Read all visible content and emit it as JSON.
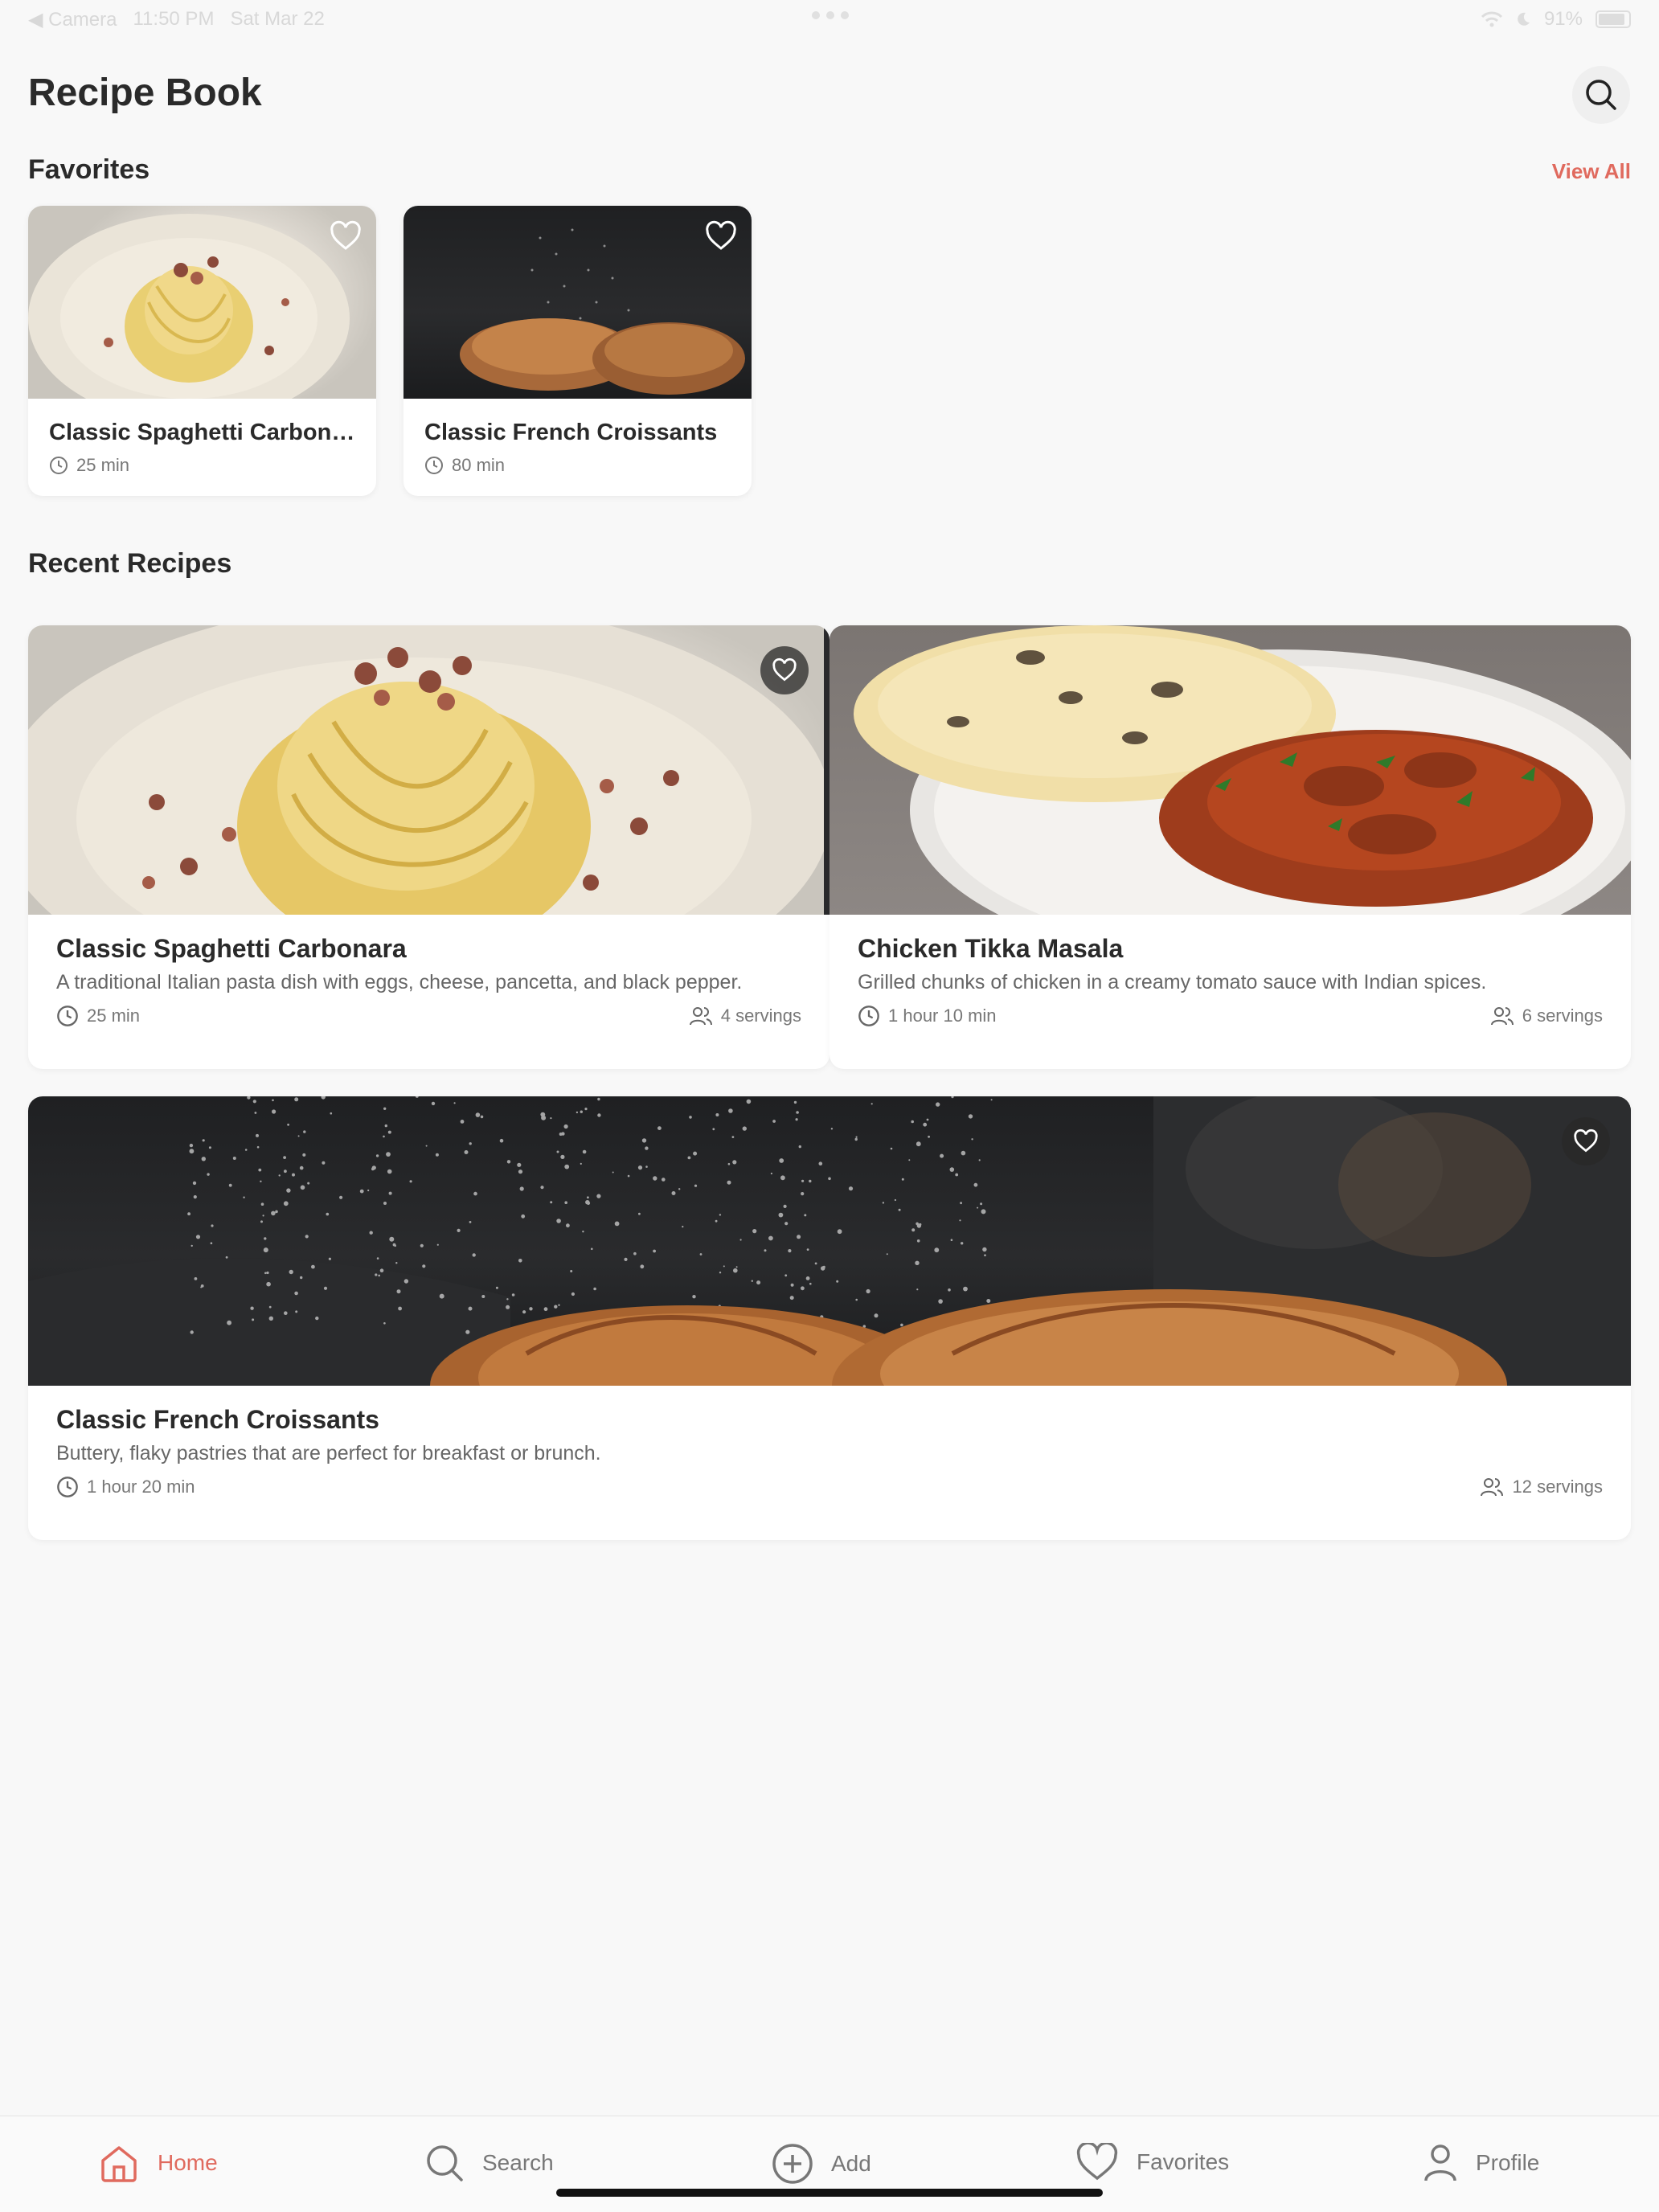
{
  "status_bar": {
    "back_label": "◀ Camera",
    "time": "11:50 PM",
    "date": "Sat Mar 22",
    "battery": "91%"
  },
  "header": {
    "title": "Recipe Book",
    "search_icon": "search-icon"
  },
  "favorites": {
    "title": "Favorites",
    "view_all": "View All",
    "cards": [
      {
        "title": "Classic Spaghetti Carbonara",
        "time": "25 min"
      },
      {
        "title": "Classic French Croissants",
        "time": "80 min"
      }
    ]
  },
  "recent": {
    "title": "Recent Recipes",
    "cards": [
      {
        "title": "Classic Spaghetti Carbonara",
        "description": "A traditional Italian pasta dish with eggs, cheese, pancetta, and black pepper.",
        "time": "25 min",
        "servings": "4 servings"
      },
      {
        "title": "Chicken Tikka Masala",
        "description": "Grilled chunks of chicken in a creamy tomato sauce with Indian spices.",
        "time": "1 hour 10 min",
        "servings": "6 servings"
      },
      {
        "title": "Classic French Croissants",
        "description": "Buttery, flaky pastries that are perfect for breakfast or brunch.",
        "time": "1 hour 20 min",
        "servings": "12 servings"
      }
    ]
  },
  "nav": {
    "items": [
      {
        "label": "Home",
        "icon": "home-icon",
        "active": true
      },
      {
        "label": "Search",
        "icon": "search-icon"
      },
      {
        "label": "Add",
        "icon": "plus-circle-icon"
      },
      {
        "label": "Favorites",
        "icon": "heart-icon"
      },
      {
        "label": "Profile",
        "icon": "user-icon"
      }
    ]
  },
  "colors": {
    "accent": "#e06a5e",
    "background": "#f8f8f8",
    "card": "#ffffff"
  }
}
